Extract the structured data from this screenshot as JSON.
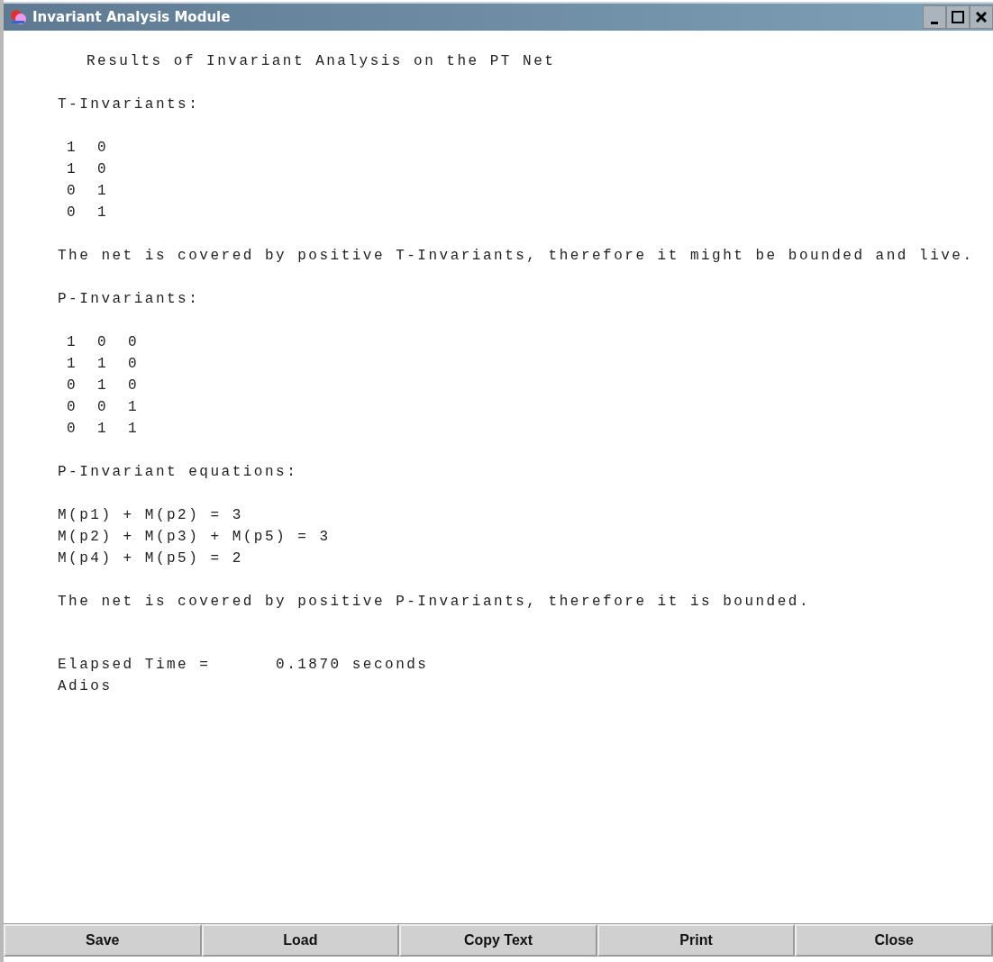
{
  "window": {
    "title": "Invariant Analysis Module"
  },
  "blocks": [
    {
      "kind": "title",
      "lines": [
        "Results of Invariant Analysis on the PT Net"
      ]
    },
    {
      "kind": "text",
      "lines": [
        "T-Invariants:"
      ]
    },
    {
      "kind": "matrix",
      "rows": [
        [
          "1",
          "0"
        ],
        [
          "1",
          "0"
        ],
        [
          "0",
          "1"
        ],
        [
          "0",
          "1"
        ]
      ]
    },
    {
      "kind": "text",
      "lines": [
        "The net is covered by positive T-Invariants, therefore it might be bounded and live."
      ]
    },
    {
      "kind": "text",
      "lines": [
        "P-Invariants:"
      ]
    },
    {
      "kind": "matrix",
      "rows": [
        [
          "1",
          "0",
          "0"
        ],
        [
          "1",
          "1",
          "0"
        ],
        [
          "0",
          "1",
          "0"
        ],
        [
          "0",
          "0",
          "1"
        ],
        [
          "0",
          "1",
          "1"
        ]
      ]
    },
    {
      "kind": "text",
      "lines": [
        "P-Invariant equations:"
      ]
    },
    {
      "kind": "text",
      "lines": [
        "M(p1) + M(p2) = 3",
        "M(p2) + M(p3) + M(p5) = 3",
        "M(p4) + M(p5) = 2"
      ]
    },
    {
      "kind": "text",
      "lines": [
        "The net is covered by positive P-Invariants, therefore it is bounded."
      ]
    },
    {
      "kind": "footer",
      "lines": [
        "Elapsed Time =      0.1870 seconds",
        "Adios"
      ]
    }
  ],
  "buttons": [
    "Save",
    "Load",
    "Copy Text",
    "Print",
    "Close"
  ]
}
